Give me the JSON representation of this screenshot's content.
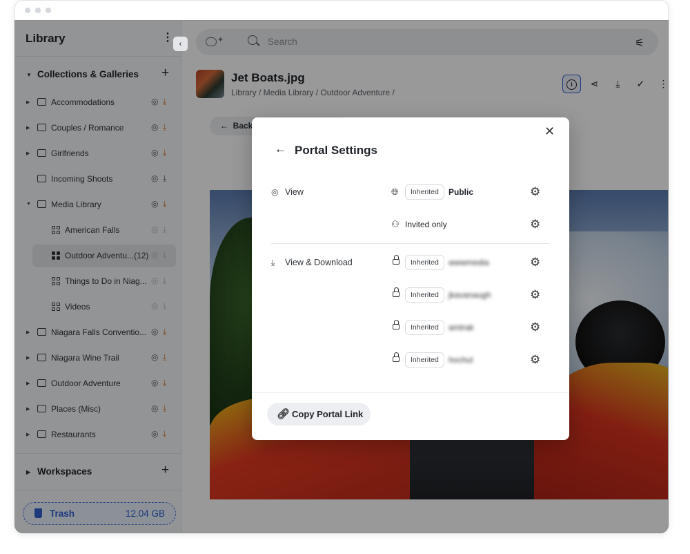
{
  "sidebar": {
    "title": "Library",
    "collapse_icon": "chevron-left",
    "collections_heading": "Collections & Galleries",
    "items": [
      {
        "label": "Accommodations"
      },
      {
        "label": "Couples / Romance"
      },
      {
        "label": "Girlfriends"
      },
      {
        "label": "Incoming Shoots"
      },
      {
        "label": "Media Library"
      },
      {
        "label": "American Falls"
      },
      {
        "label": "Outdoor Adventu...(12)"
      },
      {
        "label": "Things to Do in Niag..."
      },
      {
        "label": "Videos"
      },
      {
        "label": "Niagara Falls Conventio..."
      },
      {
        "label": "Niagara Wine Trail"
      },
      {
        "label": "Outdoor Adventure"
      },
      {
        "label": "Places (Misc)"
      },
      {
        "label": "Restaurants"
      }
    ],
    "workspaces_heading": "Workspaces",
    "trash": {
      "label": "Trash",
      "size": "12.04 GB"
    }
  },
  "search": {
    "placeholder": "Search"
  },
  "file": {
    "title": "Jet Boats.jpg",
    "breadcrumb": "Library / Media Library / Outdoor Adventure /",
    "back_label": "Back to C"
  },
  "modal": {
    "title": "Portal Settings",
    "view_label": "View",
    "view_download_label": "View & Download",
    "rows": [
      {
        "badge": "Inherited",
        "text": "Public"
      },
      {
        "badge": "",
        "text": "Invited only"
      },
      {
        "badge": "Inherited",
        "text": "wwwmedia"
      },
      {
        "badge": "Inherited",
        "text": "jkavanaugh"
      },
      {
        "badge": "Inherited",
        "text": "amtrak"
      },
      {
        "badge": "Inherited",
        "text": "hochul"
      }
    ],
    "copy_button": "Copy Portal Link"
  },
  "colors": {
    "accent": "#2d5fcf",
    "warning_download": "#d9762b",
    "overlay": "rgba(0,0,0,0.40)"
  }
}
